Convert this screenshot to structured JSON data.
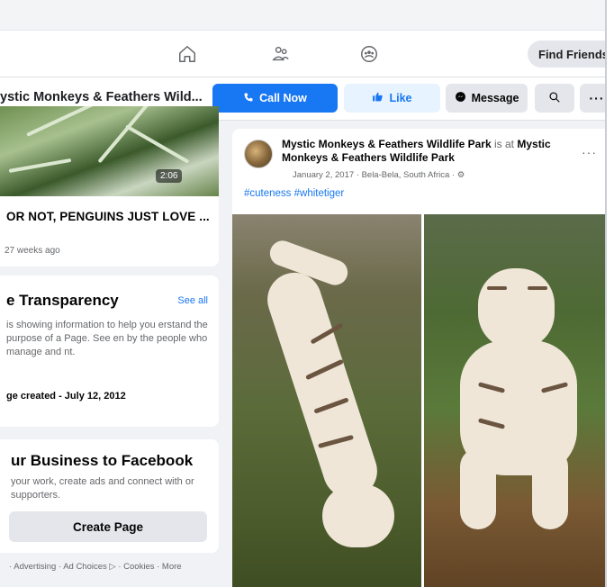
{
  "nav": {
    "find_friends": "Find Friends"
  },
  "page": {
    "name": "ystic Monkeys & Feathers Wild...",
    "call_now": "Call Now",
    "like": "Like",
    "message": "Message"
  },
  "video": {
    "duration": "2:06",
    "title": "OR NOT, PENGUINS JUST LOVE ...",
    "time": "27 weeks ago"
  },
  "transparency": {
    "title": "e Transparency",
    "see_all": "See all",
    "text": "is showing information to help you erstand the purpose of a Page. See en by the people who manage and nt.",
    "created": "ge created - July 12, 2012"
  },
  "business": {
    "title": "ur Business to Facebook",
    "text": "your work, create ads and connect with or supporters.",
    "button": "Create Page"
  },
  "footer": {
    "links": "· Advertising · Ad Choices ▷ · Cookies · More"
  },
  "post": {
    "author": "Mystic Monkeys & Feathers Wildlife Park",
    "is_at": "is at",
    "location": "Mystic Monkeys & Feathers Wildlife Park",
    "meta": "January 2, 2017 · Bela-Bela, South Africa · ⚙",
    "more": "···",
    "hashtags": "#cuteness #whitetiger"
  },
  "colors": {
    "accent": "#1877f2",
    "background": "#f0f2f5",
    "card": "#ffffff"
  }
}
